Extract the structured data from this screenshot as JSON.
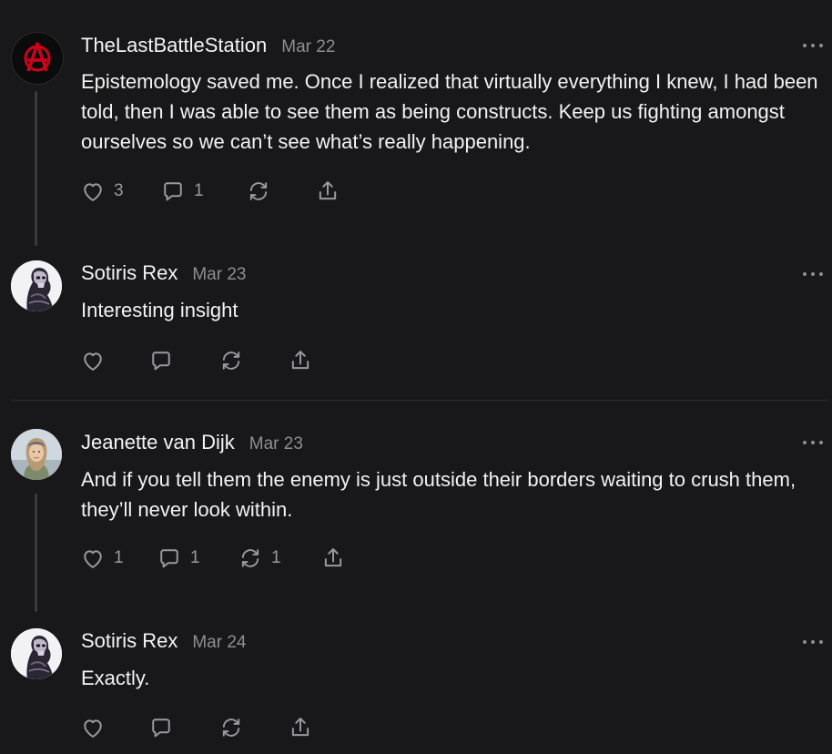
{
  "posts": [
    {
      "author": "TheLastBattleStation",
      "date": "Mar 22",
      "body": "Epistemology saved me. Once I realized that virtually everything I knew, I had been told, then I was able to see them as being constructs. Keep us fighting amongst ourselves so we can’t see what’s really happening.",
      "likes": "3",
      "comments": "1",
      "restacks": ""
    },
    {
      "author": "Sotiris Rex",
      "date": "Mar 23",
      "body": "Interesting insight",
      "likes": "",
      "comments": "",
      "restacks": ""
    },
    {
      "author": "Jeanette van Dijk",
      "date": "Mar 23",
      "body": "And if you tell them the enemy is just outside their borders waiting to crush them, they’ll never look within.",
      "likes": "1",
      "comments": "1",
      "restacks": "1"
    },
    {
      "author": "Sotiris Rex",
      "date": "Mar 24",
      "body": "Exactly.",
      "likes": "",
      "comments": "",
      "restacks": ""
    }
  ],
  "colors": {
    "background": "#18181a",
    "text": "#f2f2f2",
    "muted": "#8e8e93",
    "thread_line": "#3a3a3d",
    "anarchy_red": "#d0021b"
  },
  "icons": [
    "heart-icon",
    "comment-icon",
    "restack-icon",
    "share-icon",
    "more-dots-icon"
  ]
}
